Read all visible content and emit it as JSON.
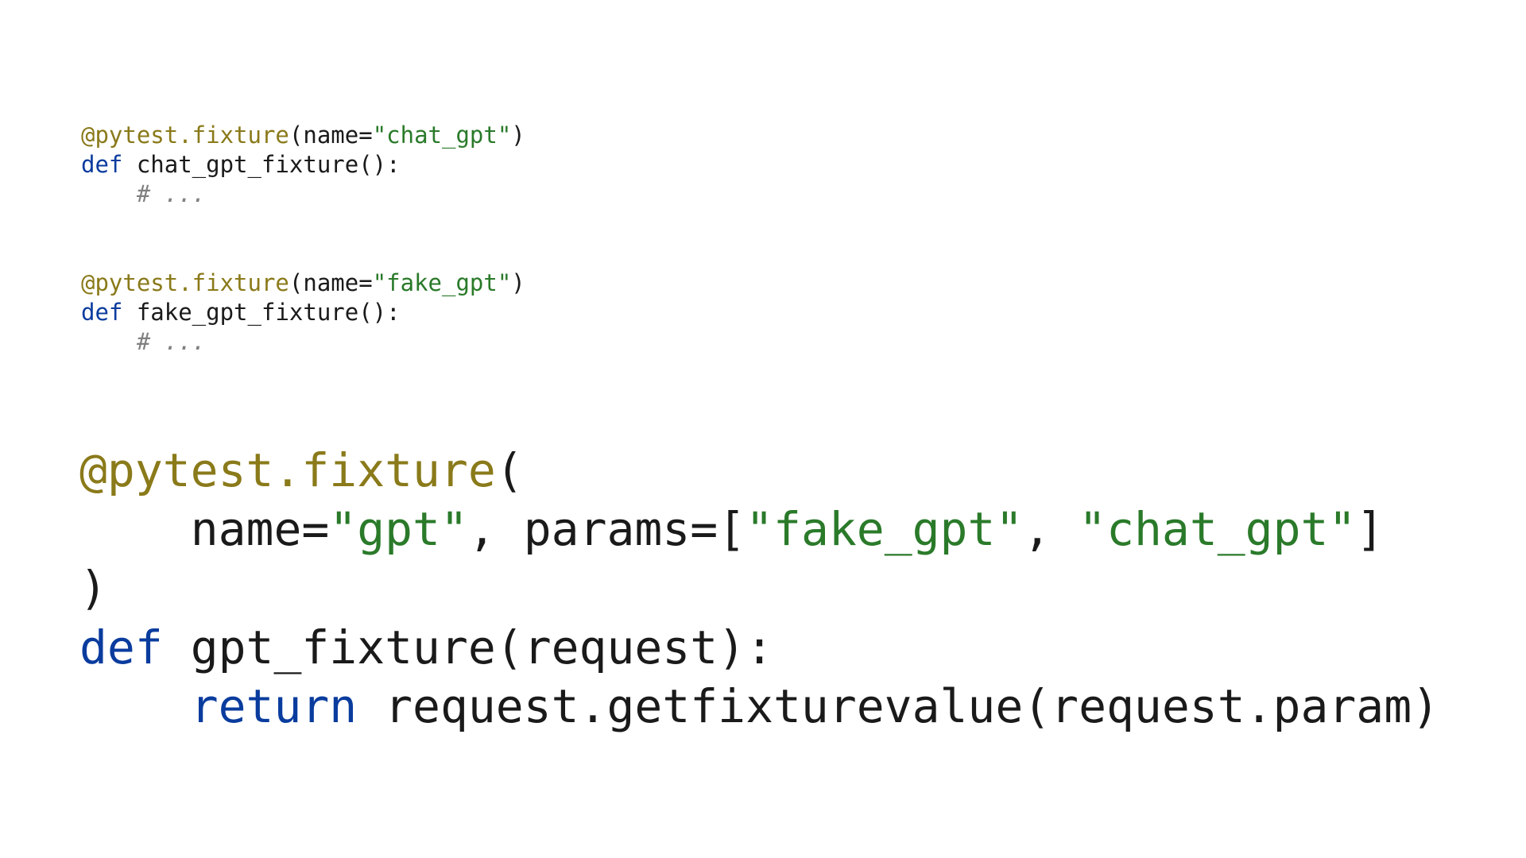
{
  "small_code": {
    "lines": [
      {
        "t": "decorator_call",
        "decorator": "@pytest.fixture",
        "open": "(",
        "kw": "name",
        "eq": "=",
        "str": "\"chat_gpt\"",
        "close": ")"
      },
      {
        "t": "def",
        "def": "def ",
        "name": "chat_gpt_fixture",
        "sig": "():"
      },
      {
        "t": "comment",
        "indent": "    ",
        "text": "# ..."
      },
      {
        "t": "blank"
      },
      {
        "t": "blank"
      },
      {
        "t": "decorator_call",
        "decorator": "@pytest.fixture",
        "open": "(",
        "kw": "name",
        "eq": "=",
        "str": "\"fake_gpt\"",
        "close": ")"
      },
      {
        "t": "def",
        "def": "def ",
        "name": "fake_gpt_fixture",
        "sig": "():"
      },
      {
        "t": "comment",
        "indent": "    ",
        "text": "# ..."
      }
    ]
  },
  "big_code": {
    "lines": [
      {
        "t": "decorator_open",
        "decorator": "@pytest.fixture",
        "open": "("
      },
      {
        "t": "args_line",
        "indent": "    ",
        "kw1": "name",
        "eq1": "=",
        "str1": "\"gpt\"",
        "comma1": ", ",
        "kw2": "params",
        "eq2": "=",
        "lbr": "[",
        "str2": "\"fake_gpt\"",
        "comma2": ", ",
        "str3": "\"chat_gpt\"",
        "rbr": "]"
      },
      {
        "t": "close_paren",
        "close": ")"
      },
      {
        "t": "def",
        "def": "def ",
        "name": "gpt_fixture",
        "sig_open": "(",
        "param": "request",
        "sig_close": "):"
      },
      {
        "t": "return_line",
        "indent": "    ",
        "ret": "return ",
        "call": "request.getfixturevalue(request.param)"
      }
    ]
  }
}
